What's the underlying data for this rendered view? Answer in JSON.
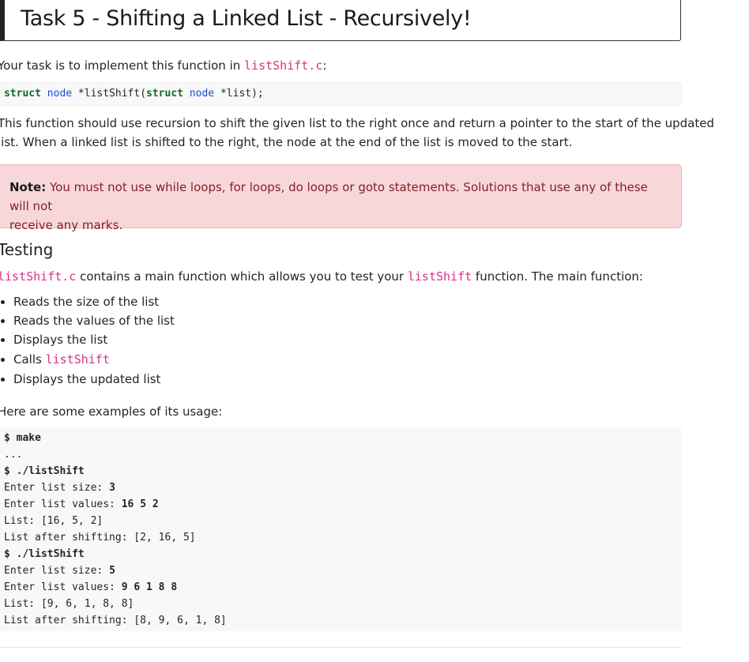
{
  "title": "Task 5 - Shifting a Linked List - Recursively!",
  "intro": {
    "prefix": "Your task is to implement this function in ",
    "file": "listShift.c",
    "suffix": ":"
  },
  "signature": {
    "kw1": "struct",
    "ty1": "node",
    "mid": " *listShift(",
    "kw2": "struct",
    "ty2": "node",
    "end": " *list);"
  },
  "description": {
    "line1": "This function should use recursion to shift the given list to the right once and return a pointer to the start of the updated",
    "line2": "list. When a linked list is shifted to the right, the node at the end of the list is moved to the start."
  },
  "note": {
    "label": "Note:",
    "line1": " You must not use while loops, for loops, do loops or goto statements. Solutions that use any of these will not",
    "line2": "receive any marks."
  },
  "testing": {
    "heading": "Testing",
    "file": "listShift.c",
    "middle": " contains a main function which allows you to test your ",
    "func": "listShift",
    "end": " function. The main function:"
  },
  "bullets": [
    "Reads the size of the list",
    "Reads the values of the list",
    "Displays the list",
    "Calls ",
    "Displays the updated list"
  ],
  "bullet_code": "listShift",
  "examples_intro": "Here are some examples of its usage:",
  "terminal": {
    "l1_prompt": "$ ",
    "l1_cmd": "make",
    "l2": "...",
    "l3_prompt": "$ ",
    "l3_cmd": "./listShift",
    "l4_label": "Enter list size: ",
    "l4_in": "3",
    "l5_label": "Enter list values: ",
    "l5_in": "16 5 2",
    "l6": "List: [16, 5, 2]",
    "l7": "List after shifting: [2, 16, 5]",
    "l8_prompt": "$ ",
    "l8_cmd": "./listShift",
    "l9_label": "Enter list size: ",
    "l9_in": "5",
    "l10_label": "Enter list values: ",
    "l10_in": "9 6 1 8 8",
    "l11": "List: [9, 6, 1, 8, 8]",
    "l12": "List after shifting: [8, 9, 6, 1, 8]"
  }
}
